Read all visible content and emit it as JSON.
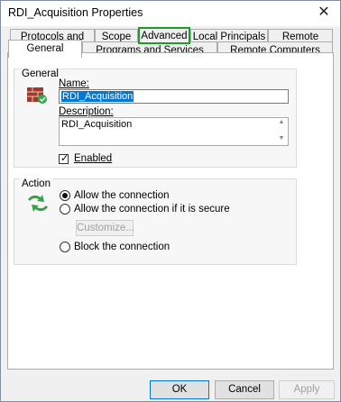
{
  "window": {
    "title": "RDI_Acquisition Properties",
    "close_glyph": "✕"
  },
  "tabs_back": [
    {
      "label": "Protocols and Ports"
    },
    {
      "label": "Scope"
    },
    {
      "label": "Advanced"
    },
    {
      "label": "Local Principals"
    },
    {
      "label": "Remote Users"
    }
  ],
  "tabs_front": [
    {
      "label": "General"
    },
    {
      "label": "Programs and Services"
    },
    {
      "label": "Remote Computers"
    }
  ],
  "general": {
    "group_label": "General",
    "name_label": "Name:",
    "name_value": "RDI_Acquisition",
    "description_label": "Description:",
    "description_value": "RDI_Acquisition",
    "enabled_label": "Enabled",
    "enabled_checked": true
  },
  "action": {
    "group_label": "Action",
    "options": [
      {
        "label": "Allow the connection",
        "selected": true
      },
      {
        "label": "Allow the connection if it is secure",
        "selected": false
      },
      {
        "label": "Block the connection",
        "selected": false
      }
    ],
    "customize_label": "Customize..."
  },
  "buttons": {
    "ok": "OK",
    "cancel": "Cancel",
    "apply": "Apply"
  },
  "highlight_color": "#1e9a2d"
}
